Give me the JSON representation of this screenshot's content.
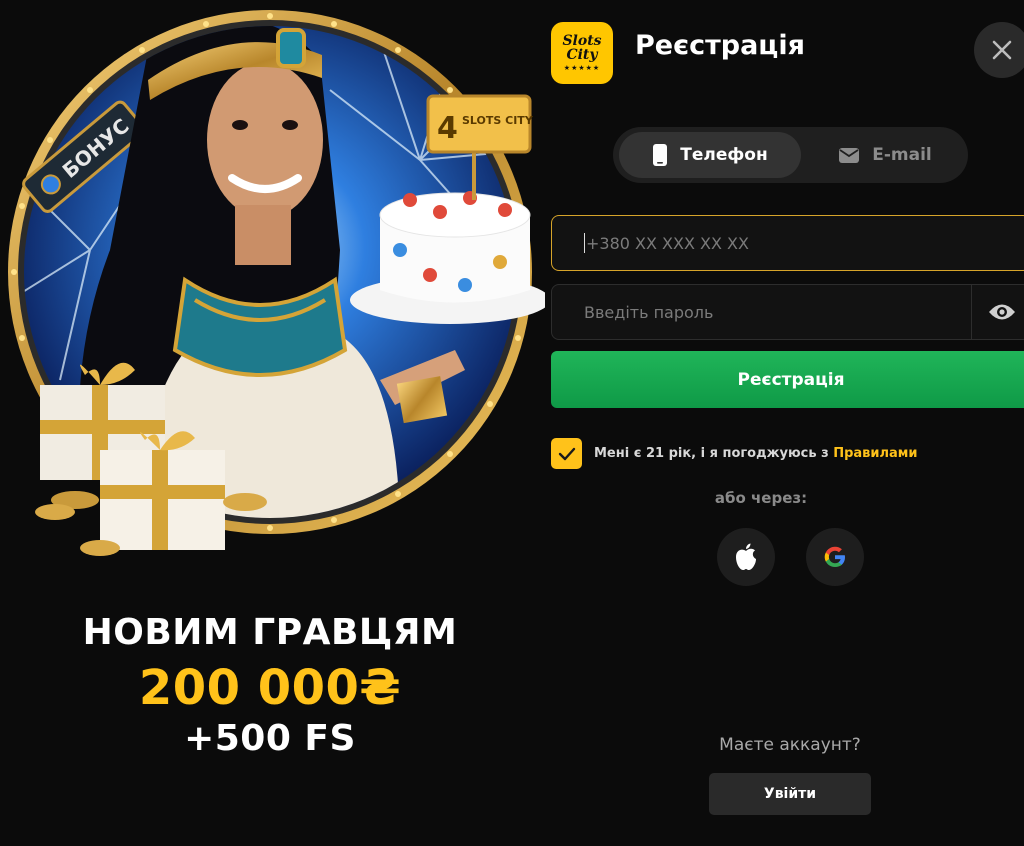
{
  "colors": {
    "accent_yellow": "#ffc21a",
    "primary_green": "#1aa851",
    "background": "#0b0b0b",
    "input_border_focus": "#d6a42a"
  },
  "promo": {
    "badge_label": "БОНУС",
    "sign_number": "4",
    "sign_text": "SLOTS CITY",
    "line1": "НОВИМ ГРАВЦЯМ",
    "line2": "200 000₴",
    "line3": "+500 FS"
  },
  "header": {
    "logo_text_line1": "Slots",
    "logo_text_line2": "City",
    "logo_stars": "★★★★★",
    "title": "Реєстрація",
    "close_icon": "close-icon"
  },
  "tabs": [
    {
      "label": "Телефон",
      "icon": "phone-icon",
      "active": true
    },
    {
      "label": "E-mail",
      "icon": "mail-icon",
      "active": false
    }
  ],
  "form": {
    "phone_placeholder": "+380 XX XXX XX XX",
    "password_placeholder": "Введіть пароль",
    "eye_icon": "eye-icon",
    "submit_label": "Реєстрація",
    "agree_text": "Мені є 21 рік, і я погоджуюсь з ",
    "agree_link": "Правилами",
    "agree_checked": true
  },
  "social": {
    "or_label": "або через:",
    "providers": [
      {
        "name": "Apple",
        "icon": "apple-icon"
      },
      {
        "name": "Google",
        "icon": "google-icon"
      }
    ]
  },
  "footer": {
    "have_account": "Маєте аккаунт?",
    "login_label": "Увійти"
  }
}
